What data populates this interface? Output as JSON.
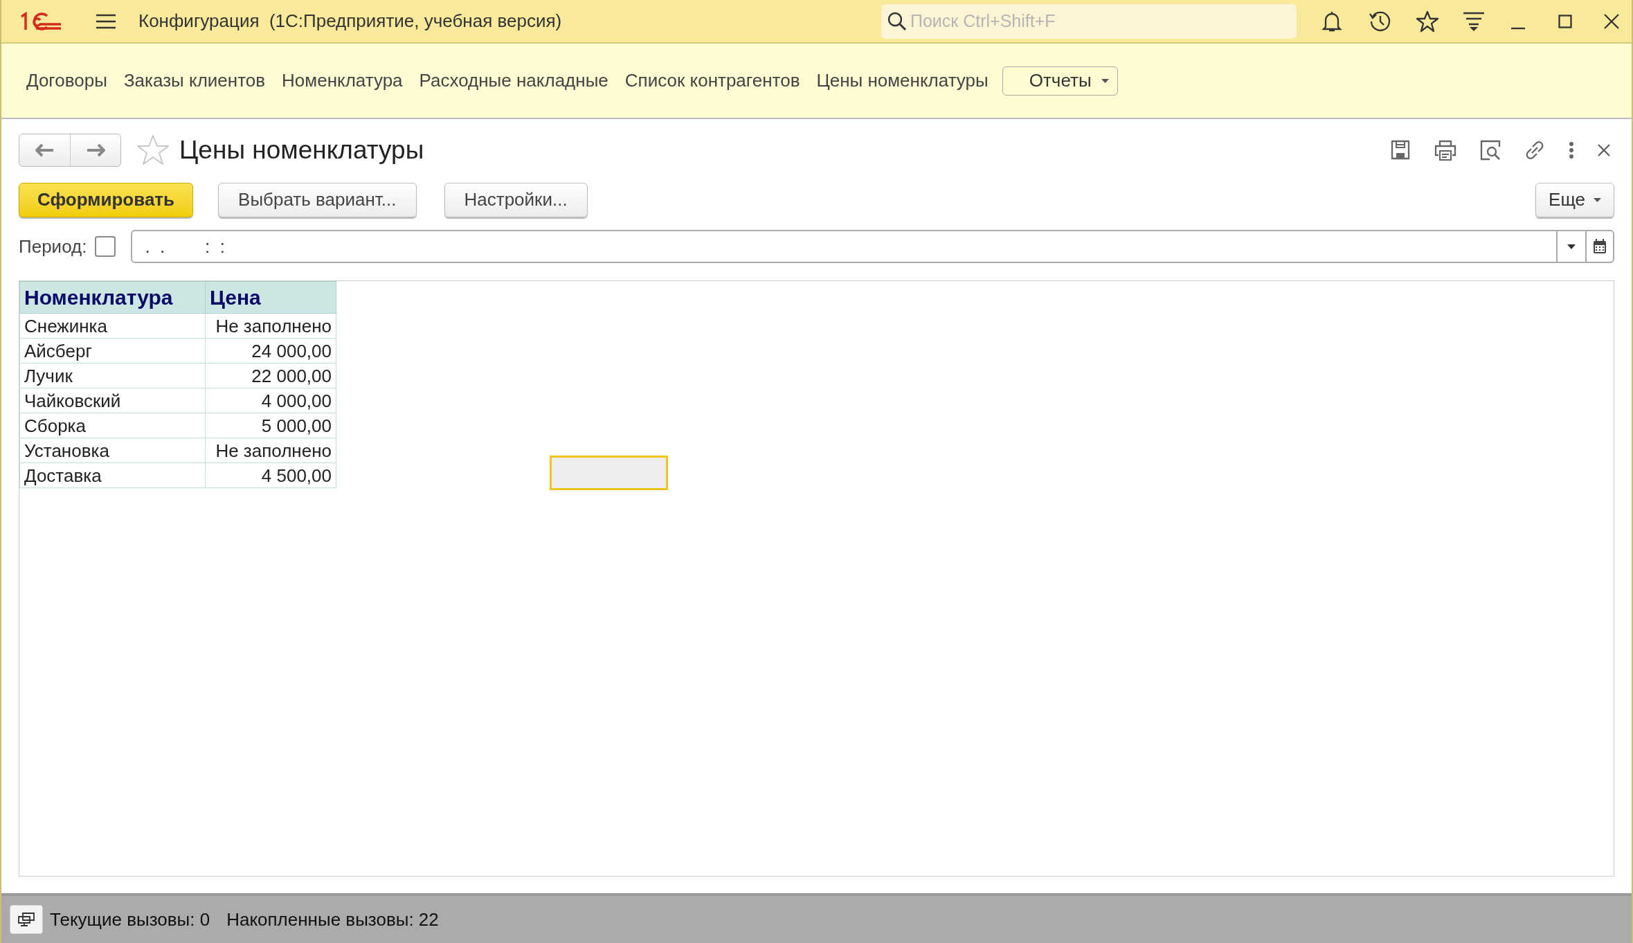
{
  "window": {
    "title": "Конфигурация  (1С:Предприятие, учебная версия)",
    "search": {
      "placeholder": "Поиск Ctrl+Shift+F"
    }
  },
  "nav": {
    "items": [
      "Договоры",
      "Заказы клиентов",
      "Номенклатура",
      "Расходные накладные",
      "Список контрагентов",
      "Цены номенклатуры"
    ],
    "menu": "Отчеты"
  },
  "form": {
    "title": "Цены номенклатуры",
    "favorite": false,
    "buttons": [
      {
        "label": "Сформировать",
        "kind": "primary"
      },
      {
        "label": "Выбрать вариант...",
        "kind": "normal"
      },
      {
        "label": "Настройки...",
        "kind": "normal"
      }
    ],
    "more": "Еще",
    "period": {
      "label": "Период:",
      "checked": false,
      "value": ".  .        :  :"
    }
  },
  "report": {
    "columns": [
      "Номенклатура",
      "Цена"
    ],
    "rows": [
      [
        "Снежинка",
        "Не заполнено"
      ],
      [
        "Айсберг",
        "24 000,00"
      ],
      [
        "Лучик",
        "22 000,00"
      ],
      [
        "Чайковский",
        "4 000,00"
      ],
      [
        "Сборка",
        "5 000,00"
      ],
      [
        "Установка",
        "Не заполнено"
      ],
      [
        "Доставка",
        "4 500,00"
      ]
    ]
  },
  "status_bar": {
    "items": [
      "Текущие вызовы: 0",
      "Накопленные вызовы: 22"
    ]
  }
}
